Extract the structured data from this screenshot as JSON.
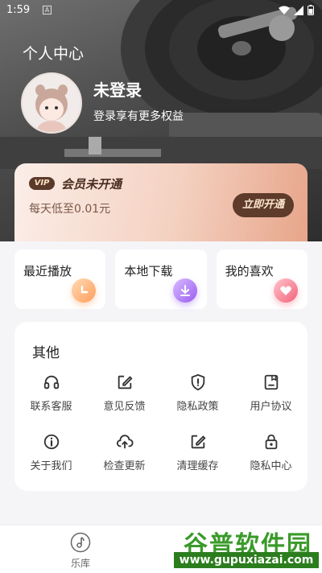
{
  "status_bar": {
    "time": "1:59",
    "notification_glyph": "A"
  },
  "header": {
    "title": "个人中心",
    "user_name": "未登录",
    "user_subtitle": "登录享有更多权益"
  },
  "vip": {
    "badge": "VIP",
    "title": "会员未开通",
    "price_text": "每天低至0.01元",
    "button_label": "立即开通"
  },
  "quick_cards": [
    {
      "label": "最近播放",
      "icon": "clock-icon"
    },
    {
      "label": "本地下载",
      "icon": "download-icon"
    },
    {
      "label": "我的喜欢",
      "icon": "heart-icon"
    }
  ],
  "others": {
    "title": "其他",
    "items": [
      {
        "label": "联系客服",
        "icon": "headset-icon"
      },
      {
        "label": "意见反馈",
        "icon": "edit-icon"
      },
      {
        "label": "隐私政策",
        "icon": "shield-icon"
      },
      {
        "label": "用户协议",
        "icon": "document-icon"
      },
      {
        "label": "关于我们",
        "icon": "info-icon"
      },
      {
        "label": "检查更新",
        "icon": "cloud-upload-icon"
      },
      {
        "label": "清理缓存",
        "icon": "edit-icon"
      },
      {
        "label": "隐私中心",
        "icon": "lock-icon"
      }
    ]
  },
  "bottom_nav": {
    "tab_music": "乐库"
  },
  "watermark": {
    "main": "谷普软件园",
    "url": "www.gupuxiazai.com"
  },
  "colors": {
    "vip_dark": "#5e3b2b",
    "clock_accent": "#ff9f5a",
    "download_accent": "#9b5cf0",
    "heart_accent": "#f2627a",
    "watermark_green": "#3a9a2a"
  }
}
